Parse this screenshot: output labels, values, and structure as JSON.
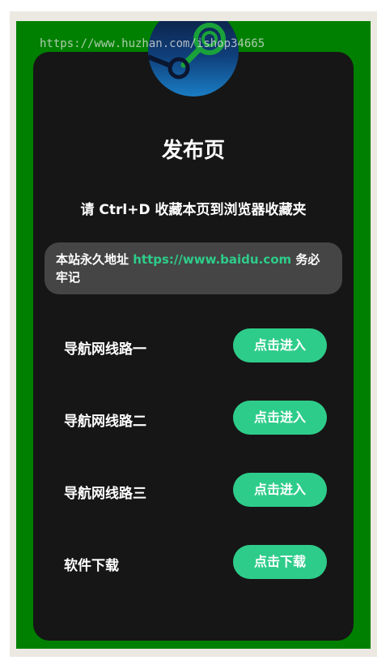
{
  "watermark": "https://www.huzhan.com/ishop34665",
  "page": {
    "title": "发布页",
    "bookmark_tip": "请 Ctrl+D 收藏本页到浏览器收藏夹"
  },
  "notice": {
    "prefix": "本站永久地址 ",
    "url": "https://www.baidu.com",
    "suffix": " 务必牢记"
  },
  "routes": [
    {
      "label": "导航网线路一",
      "button": "点击进入"
    },
    {
      "label": "导航网线路二",
      "button": "点击进入"
    },
    {
      "label": "导航网线路三",
      "button": "点击进入"
    },
    {
      "label": "软件下载",
      "button": "点击下载"
    }
  ],
  "colors": {
    "page_bg": "#008000",
    "card_bg": "#161616",
    "accent": "#2ecc8a",
    "notice_bg": "#454545"
  },
  "logo_icon": "steam-logo-icon"
}
